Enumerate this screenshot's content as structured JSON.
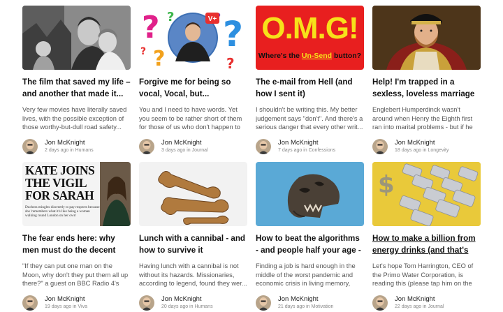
{
  "cards": [
    {
      "title": "The film that saved my life – and another that made it...",
      "excerpt": "Very few movies have literally saved lives, with the possible exception of those worthy-but-dull road safety...",
      "author": "Jon McKnight",
      "age": "2 days ago in",
      "category": "Humans"
    },
    {
      "title": "Forgive me for being so vocal, Vocal, but...",
      "excerpt": "You and I need to have words. Yet you seem to be rather short of them for those of us who don't happen to be...",
      "author": "Jon McKnight",
      "age": "3 days ago in",
      "category": "Journal",
      "thumb_badge": "V+"
    },
    {
      "title": "The e-mail from Hell (and how I sent it)",
      "excerpt": "I shouldn't be writing this. My better judgement says \"don't\". And there's a serious danger that every other writ...",
      "author": "Jon McKnight",
      "age": "7 days ago in",
      "category": "Confessions",
      "thumb_headline": "O.M.G!",
      "thumb_caption_pre": "Where's the ",
      "thumb_caption_em": "Un-Send",
      "thumb_caption_post": " button?"
    },
    {
      "title": "Help! I'm trapped in a sexless, loveless marriage",
      "excerpt": "Englebert Humperdinck wasn't around when Henry the Eighth first ran into marital problems - but if he had bee...",
      "author": "Jon McKnight",
      "age": "18 days ago in",
      "category": "Longevity"
    },
    {
      "title": "The fear ends here: why men must do the decent thing",
      "excerpt": "\"If they can put one man on the Moon, why don't they put them all up there?\" a guest on BBC Radio 4's Woman's...",
      "author": "Jon McKnight",
      "age": "19 days ago in",
      "category": "Viva",
      "thumb_headline": "KATE JOINS THE VIGIL FOR SARAH",
      "thumb_text": "Duchess mingles discreetly to pay respects because she 'remembers what it's like being a woman walking round London on her own'"
    },
    {
      "title": "Lunch with a cannibal - and how to survive it",
      "excerpt": "Having lunch with a cannibal is not without its hazards. Missionaries, according to legend, found they wer...",
      "author": "Jon McKnight",
      "age": "20 days ago in",
      "category": "Humans"
    },
    {
      "title": "How to beat the algorithms - and people half your age - to...",
      "excerpt": "Finding a job is hard enough in the middle of the worst pandemic and economic crisis in living memory, but...",
      "author": "Jon McKnight",
      "age": "21 days ago in",
      "category": "Motivation"
    },
    {
      "title": "How to make a billion from energy drinks (and that's no...",
      "excerpt": "Let's hope Tom Harrington, CEO of the Primo Water Corporation, is reading this (please tap him on the shoulder,...",
      "author": "Jon McKnight",
      "age": "22 days ago in",
      "category": "Journal",
      "underlined": true
    }
  ],
  "colors": {
    "omg_bg": "#e81f1f",
    "omg_text": "#f7e11a",
    "money_bg": "#e9c93a"
  }
}
